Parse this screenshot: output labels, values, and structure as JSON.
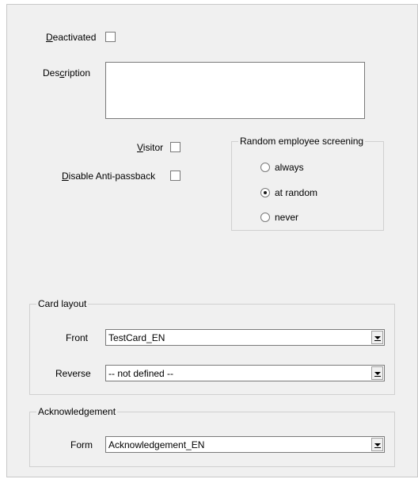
{
  "deactivated": {
    "prefix": "",
    "mnemonic": "D",
    "rest": "eactivated",
    "checked": false
  },
  "description": {
    "prefix": "Des",
    "mnemonic": "c",
    "rest": "ription",
    "value": ""
  },
  "visitor": {
    "prefix": "",
    "mnemonic": "V",
    "rest": "isitor",
    "checked": false
  },
  "disable_antipassback": {
    "prefix": "",
    "mnemonic": "D",
    "rest": "isable Anti-passback",
    "checked": false
  },
  "random_screening": {
    "title": "Random employee screening",
    "options": [
      {
        "label": "always",
        "selected": false
      },
      {
        "label": "at random",
        "selected": true
      },
      {
        "label": "never",
        "selected": false
      }
    ]
  },
  "card_layout": {
    "title": "Card layout",
    "front": {
      "label": "Front",
      "value": "TestCard_EN"
    },
    "reverse": {
      "label": "Reverse",
      "value": "-- not defined --"
    }
  },
  "acknowledgement": {
    "title": "Acknowledgement",
    "form": {
      "label": "Form",
      "value": "Acknowledgement_EN"
    }
  }
}
